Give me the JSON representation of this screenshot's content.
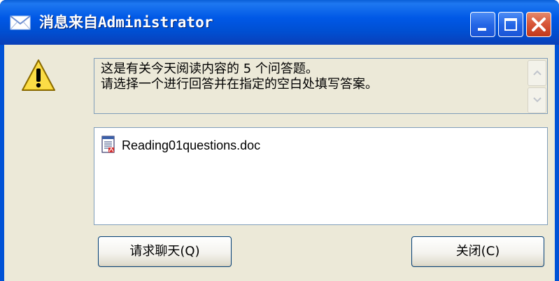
{
  "window": {
    "title": "消息来自Administrator"
  },
  "message": {
    "text": "这是有关今天阅读内容的 5 个问答题。\n请选择一个进行回答并在指定的空白处填写答案。"
  },
  "attachments": [
    {
      "name": "Reading01questions.doc",
      "icon": "word-document-icon"
    }
  ],
  "buttons": {
    "chat_label": "请求聊天(Q)",
    "close_label": "关闭(C)"
  },
  "icons": {
    "title": "envelope-icon",
    "alert": "warning-icon"
  },
  "colors": {
    "titlebar": "#0058e6",
    "client": "#ece9d8",
    "close_button": "#d9583a",
    "border": "#7f9db9"
  }
}
